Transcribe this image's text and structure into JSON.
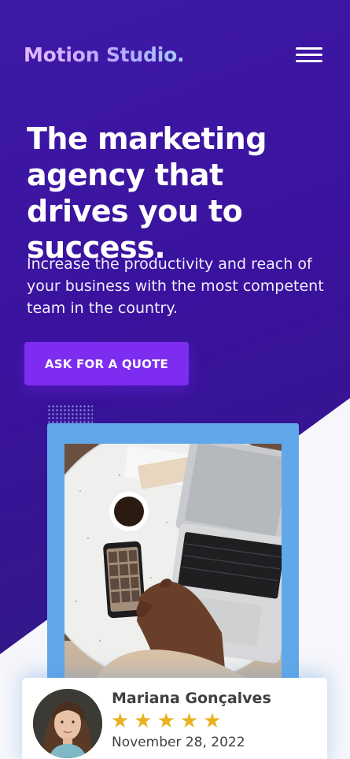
{
  "brand": {
    "name": "Motion Studio",
    "dot": "."
  },
  "hero": {
    "headline": "The marketing agency that drives you to success.",
    "subtext": "Increase the productivity and reach of your business with the most competent team in the country.",
    "cta_label": "ASK FOR A QUOTE"
  },
  "review": {
    "name": "Mariana Gonçalves",
    "stars": "★★★★★",
    "rating": 5,
    "date": "November 28, 2022"
  },
  "colors": {
    "hero_background": "#3a129e",
    "cta": "#7d2cf0",
    "photo_frame": "#61a8ea",
    "star": "#e8b21e"
  },
  "icons": {
    "menu": "hamburger-menu-icon"
  }
}
